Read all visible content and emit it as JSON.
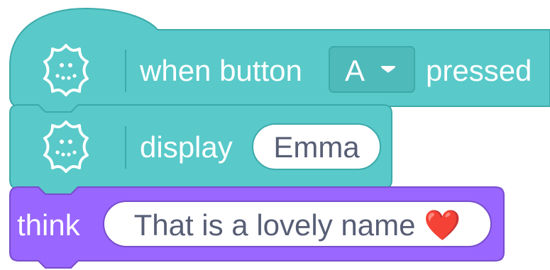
{
  "blocks": {
    "hat": {
      "prefix": "when button",
      "dropdown_value": "A",
      "suffix": "pressed",
      "icon": "microbit-icon",
      "color": "#59C9C9",
      "stroke": "#3DAAAA"
    },
    "display": {
      "label": "display",
      "value": "Emma",
      "icon": "microbit-icon",
      "color": "#59C9C9",
      "stroke": "#3DAAAA"
    },
    "think": {
      "label": "think",
      "value": "That is a lovely name ❤️",
      "color": "#9966FF",
      "stroke": "#774DCB"
    }
  },
  "colors": {
    "input_text": "#575E75",
    "dropdown_text": "#ffffff"
  }
}
